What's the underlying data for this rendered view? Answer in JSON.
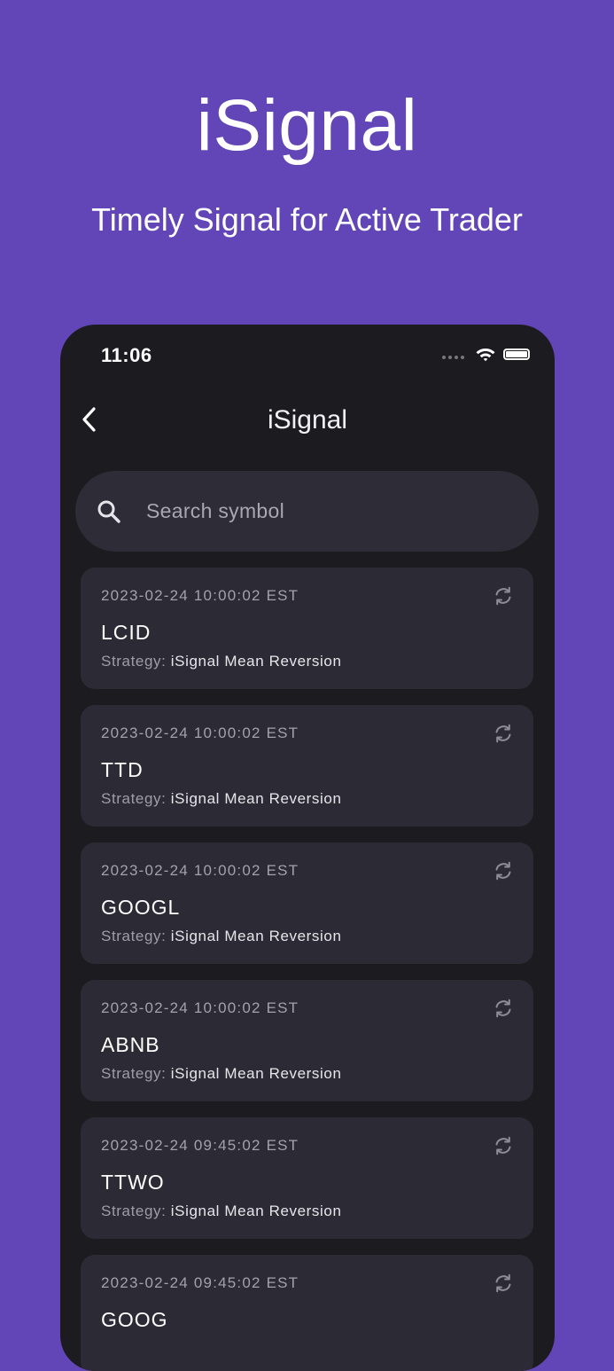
{
  "promo": {
    "title": "iSignal",
    "subtitle": "Timely Signal for Active Trader"
  },
  "status_bar": {
    "time": "11:06"
  },
  "header": {
    "title": "iSignal",
    "back_icon": "chevron-left-icon"
  },
  "search": {
    "placeholder": "Search symbol",
    "value": "",
    "icon": "search-icon"
  },
  "signals": [
    {
      "time": "2023-02-24 10:00:02 EST",
      "symbol": "LCID",
      "strategy_label": "Strategy: ",
      "strategy": "iSignal Mean Reversion"
    },
    {
      "time": "2023-02-24 10:00:02 EST",
      "symbol": "TTD",
      "strategy_label": "Strategy: ",
      "strategy": "iSignal Mean Reversion"
    },
    {
      "time": "2023-02-24 10:00:02 EST",
      "symbol": "GOOGL",
      "strategy_label": "Strategy: ",
      "strategy": "iSignal Mean Reversion"
    },
    {
      "time": "2023-02-24 10:00:02 EST",
      "symbol": "ABNB",
      "strategy_label": "Strategy: ",
      "strategy": "iSignal Mean Reversion"
    },
    {
      "time": "2023-02-24 09:45:02 EST",
      "symbol": "TTWO",
      "strategy_label": "Strategy: ",
      "strategy": "iSignal Mean Reversion"
    },
    {
      "time": "2023-02-24 09:45:02 EST",
      "symbol": "GOOG"
    }
  ],
  "colors": {
    "background": "#6246b7",
    "phone_background": "#1c1b20",
    "card_background": "#2c2a34",
    "search_background": "#2e2c36"
  }
}
